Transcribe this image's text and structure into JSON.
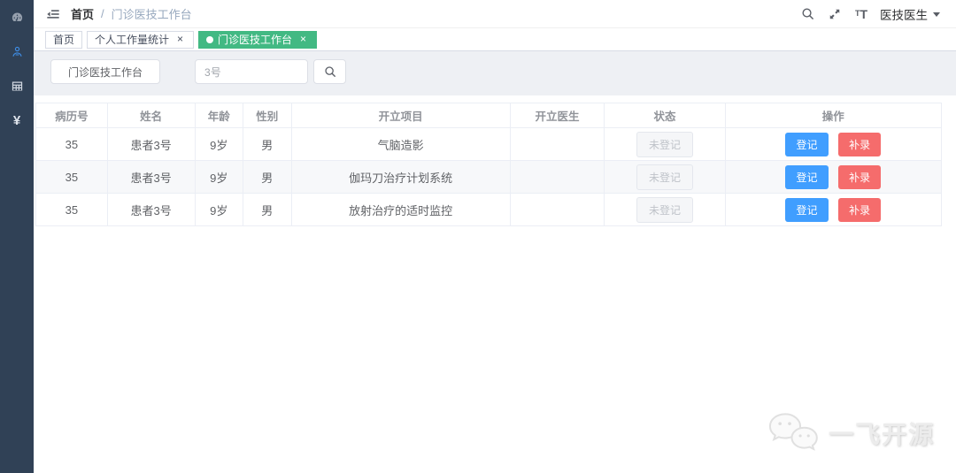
{
  "colors": {
    "sidebar_bg": "#304156",
    "active_tab_green": "#42b983",
    "primary_blue": "#409eff",
    "danger_red": "#f56c6c"
  },
  "navbar": {
    "breadcrumb": {
      "root": "首页",
      "separator": "/",
      "current": "门诊医技工作台"
    },
    "user": {
      "label": "医技医生"
    }
  },
  "tabs": [
    {
      "label": "首页"
    },
    {
      "label": "个人工作量统计",
      "close": "×"
    },
    {
      "label": "门诊医技工作台",
      "close": "×"
    }
  ],
  "toolbar": {
    "workbench_button": "门诊医技工作台",
    "search_value": "3号"
  },
  "table": {
    "columns": [
      "病历号",
      "姓名",
      "年龄",
      "性别",
      "开立项目",
      "开立医生",
      "状态",
      "操作"
    ],
    "rows": [
      {
        "record_no": "35",
        "name": "患者3号",
        "age": "9岁",
        "gender": "男",
        "project": "气脑造影",
        "doctor": "",
        "status": "未登记",
        "actions": [
          "登记",
          "补录"
        ]
      },
      {
        "record_no": "35",
        "name": "患者3号",
        "age": "9岁",
        "gender": "男",
        "project": "伽玛刀治疗计划系统",
        "doctor": "",
        "status": "未登记",
        "actions": [
          "登记",
          "补录"
        ]
      },
      {
        "record_no": "35",
        "name": "患者3号",
        "age": "9岁",
        "gender": "男",
        "project": "放射治疗的适时监控",
        "doctor": "",
        "status": "未登记",
        "actions": [
          "登记",
          "补录"
        ]
      }
    ]
  },
  "watermark": {
    "text": "一飞开源"
  }
}
